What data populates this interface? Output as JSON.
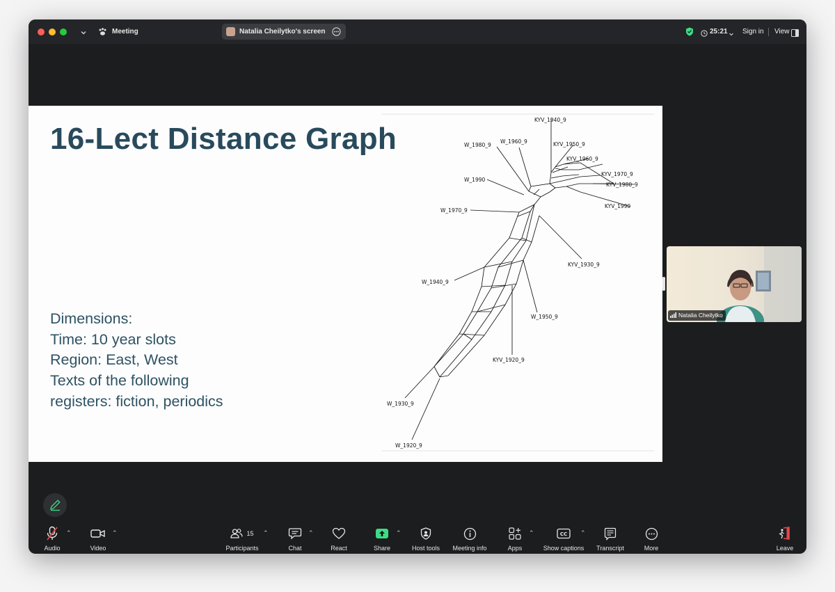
{
  "titlebar": {
    "app_name": "Meeting",
    "share_label": "Natalia Cheilytko's screen",
    "timer": "25:21",
    "sign_in": "Sign in",
    "view": "View"
  },
  "slide": {
    "title": "16-Lect Distance Graph",
    "dimensions": [
      "Dimensions:",
      "Time: 10 year slots",
      "Region: East, West",
      "Texts of the following",
      "registers: fiction, periodics"
    ],
    "graph_labels": {
      "kyv1940": "KYV_1940_9",
      "w1980": "W_1980_9",
      "w1960": "W_1960_9",
      "kyv1950": "KYV_1950_9",
      "kyv1960": "KYV_1960_9",
      "kyv1970": "KYV_1970_9",
      "kyv1980": "KYV_1980_9",
      "w1990": "W_1990",
      "kyv1990": "KYV_1990",
      "w1970": "W_1970_9",
      "kyv1930": "KYV_1930_9",
      "w1940": "W_1940_9",
      "w1950": "W_1950_9",
      "kyv1920": "KYV_1920_9",
      "w1930": "W_1930_9",
      "w1920": "W_1920_9"
    }
  },
  "participant_video": {
    "name": "Natalia Cheilytko"
  },
  "toolbar": {
    "audio": "Audio",
    "video": "Video",
    "participants": "Participants",
    "participants_count": "15",
    "chat": "Chat",
    "react": "React",
    "share": "Share",
    "host_tools": "Host tools",
    "meeting_info": "Meeting info",
    "apps": "Apps",
    "show_captions": "Show captions",
    "transcript": "Transcript",
    "more": "More",
    "leave": "Leave"
  },
  "colors": {
    "title_text": "#284a5c",
    "body_text": "#2e5263",
    "share_green": "#3ddc84",
    "leave_red": "#e5484d",
    "mic_muted": "#e5484d"
  }
}
